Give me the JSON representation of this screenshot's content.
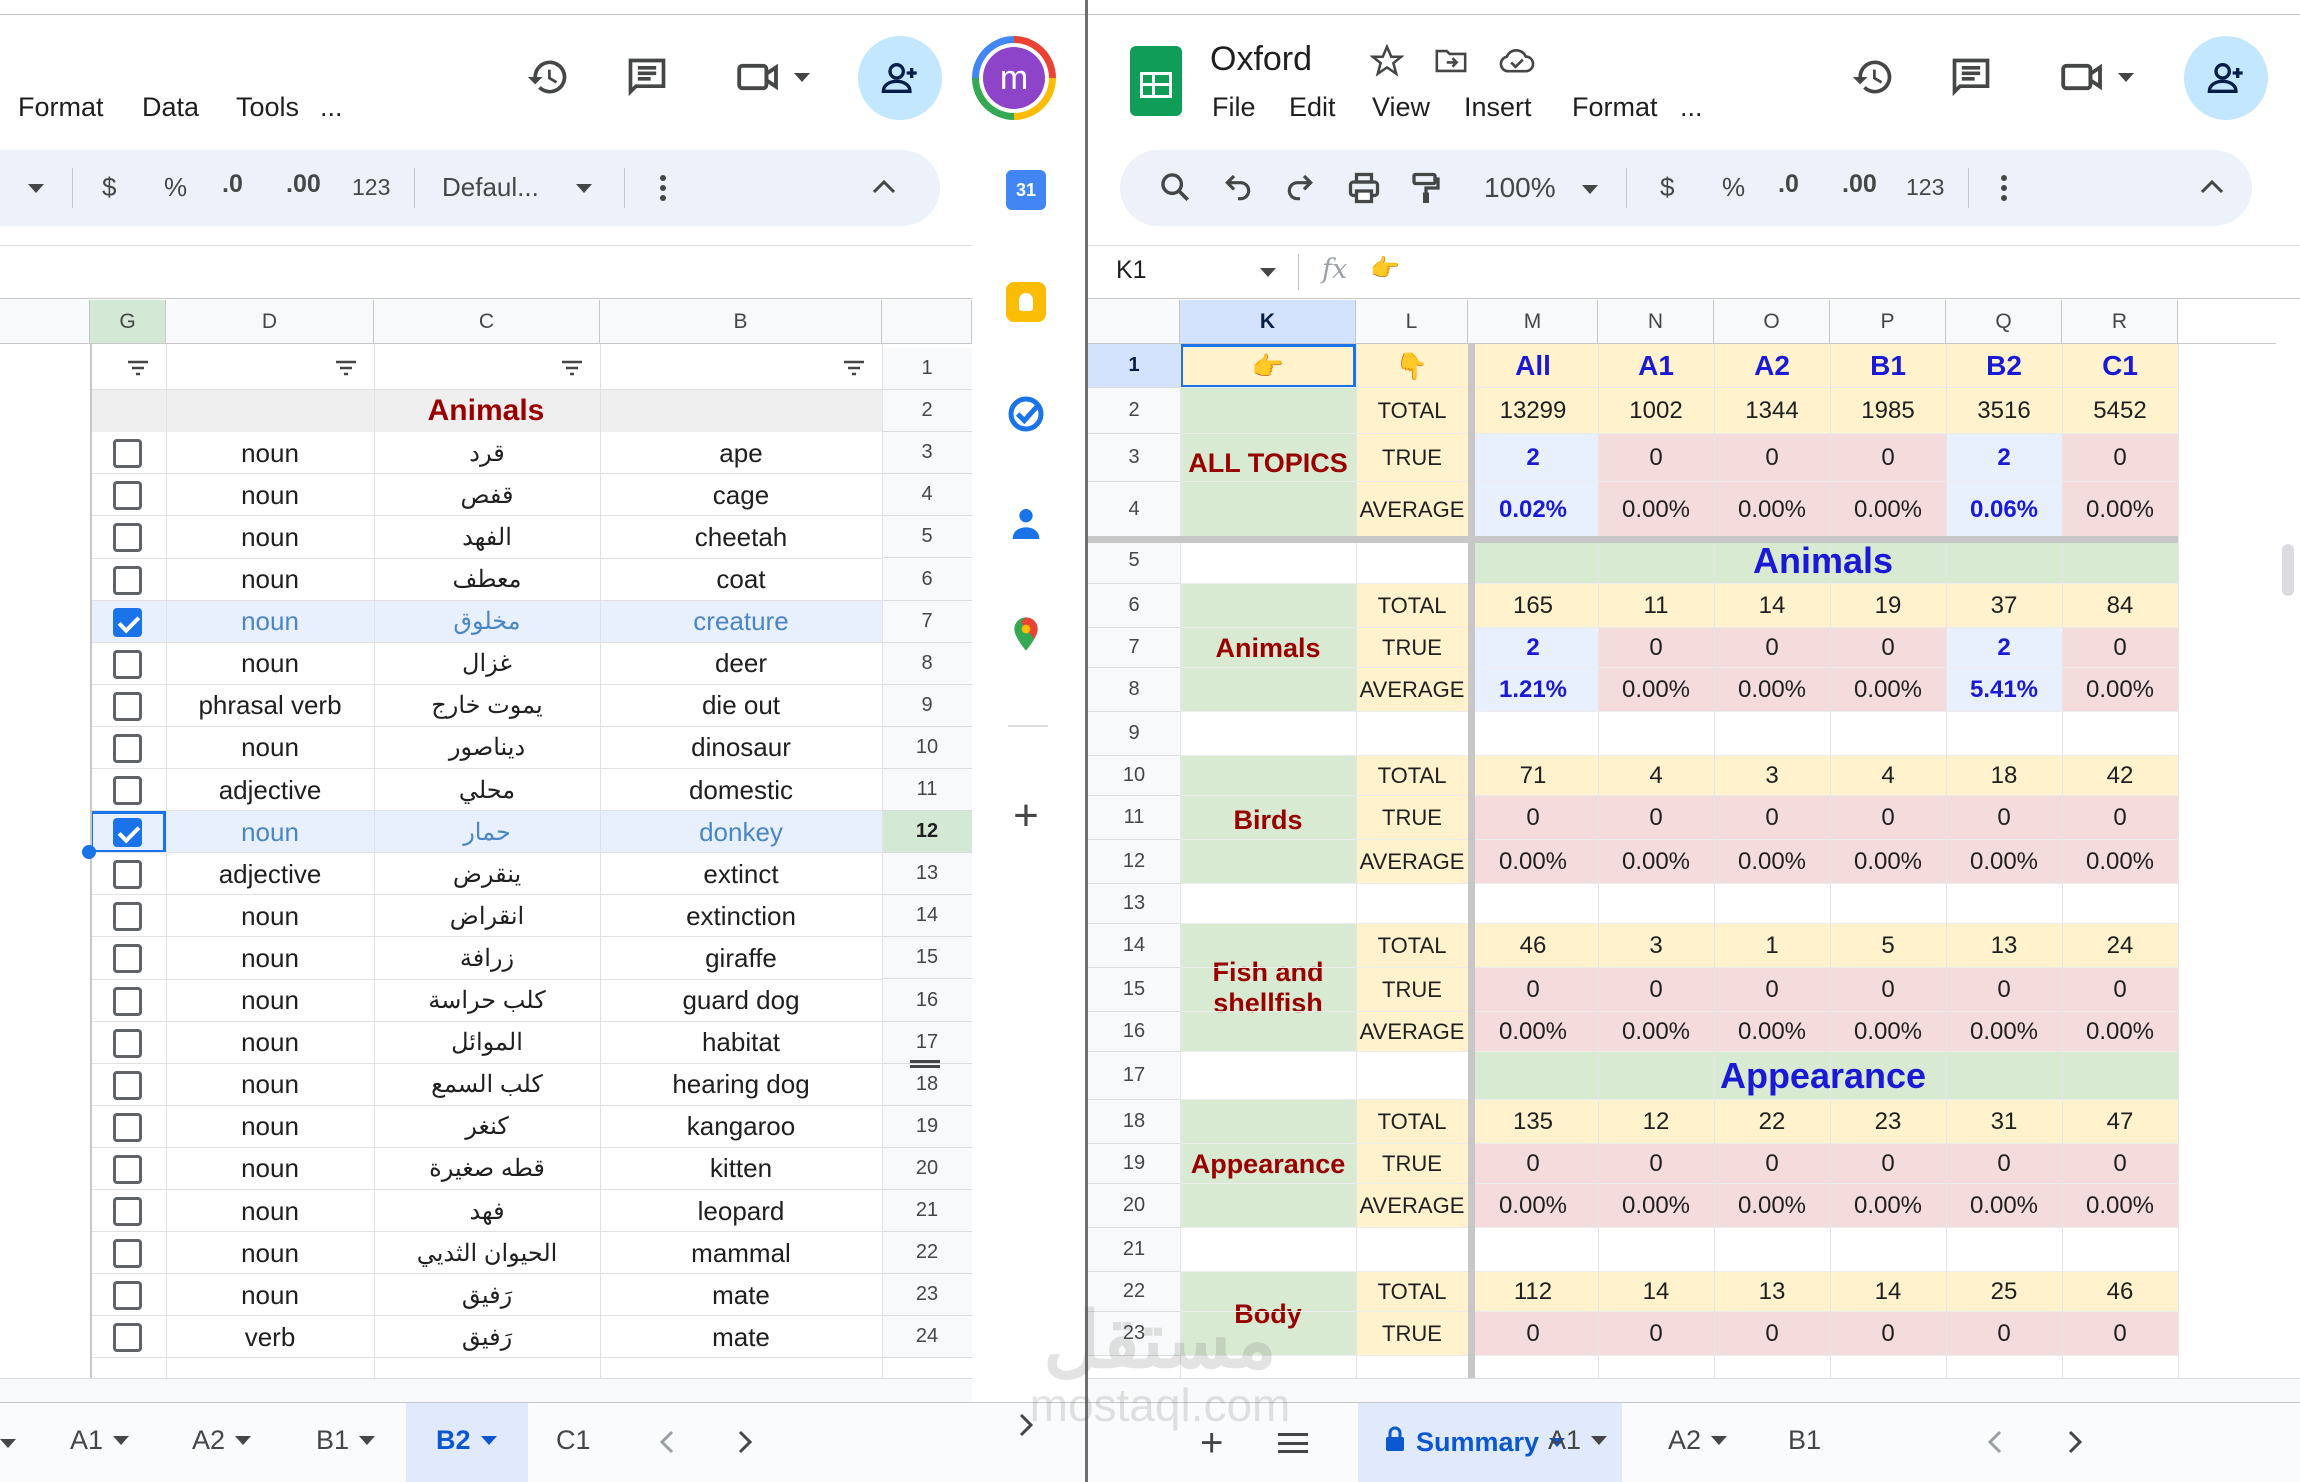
{
  "left": {
    "menu": [
      "Format",
      "Data",
      "Tools",
      "..."
    ],
    "toolbar": {
      "currency": "$",
      "percent": "%",
      "dec_minus": ".0",
      "dec_plus": ".00",
      "num_format": "123",
      "font": "Defaul..."
    },
    "avatar_letter": "m",
    "col_headers": [
      "G",
      "D",
      "C",
      "B"
    ],
    "section_title": "Animals",
    "rows": [
      {
        "n": "1",
        "d": "",
        "c": "",
        "b": "",
        "checked": false
      },
      {
        "n": "2",
        "d": "",
        "c": "",
        "b": "",
        "checked": false
      },
      {
        "n": "3",
        "d": "noun",
        "c": "قرد",
        "b": "ape",
        "checked": false
      },
      {
        "n": "4",
        "d": "noun",
        "c": "قفص",
        "b": "cage",
        "checked": false
      },
      {
        "n": "5",
        "d": "noun",
        "c": "الفهد",
        "b": "cheetah",
        "checked": false
      },
      {
        "n": "6",
        "d": "noun",
        "c": "معطف",
        "b": "coat",
        "checked": false
      },
      {
        "n": "7",
        "d": "noun",
        "c": "مخلوق",
        "b": "creature",
        "checked": true
      },
      {
        "n": "8",
        "d": "noun",
        "c": "غزال",
        "b": "deer",
        "checked": false
      },
      {
        "n": "9",
        "d": "phrasal verb",
        "c": "يموت خارج",
        "b": "die out",
        "checked": false
      },
      {
        "n": "10",
        "d": "noun",
        "c": "ديناصور",
        "b": "dinosaur",
        "checked": false
      },
      {
        "n": "11",
        "d": "adjective",
        "c": "محلي",
        "b": "domestic",
        "checked": false
      },
      {
        "n": "12",
        "d": "noun",
        "c": "حمار",
        "b": "donkey",
        "checked": true
      },
      {
        "n": "13",
        "d": "adjective",
        "c": "ينقرض",
        "b": "extinct",
        "checked": false
      },
      {
        "n": "14",
        "d": "noun",
        "c": "انقراض",
        "b": "extinction",
        "checked": false
      },
      {
        "n": "15",
        "d": "noun",
        "c": "زرافة",
        "b": "giraffe",
        "checked": false
      },
      {
        "n": "16",
        "d": "noun",
        "c": "كلب حراسة",
        "b": "guard dog",
        "checked": false
      },
      {
        "n": "17",
        "d": "noun",
        "c": "الموائل",
        "b": "habitat",
        "checked": false
      },
      {
        "n": "18",
        "d": "noun",
        "c": "كلب السمع",
        "b": "hearing dog",
        "checked": false
      },
      {
        "n": "19",
        "d": "noun",
        "c": "كنغر",
        "b": "kangaroo",
        "checked": false
      },
      {
        "n": "20",
        "d": "noun",
        "c": "قطه صغيرة",
        "b": "kitten",
        "checked": false
      },
      {
        "n": "21",
        "d": "noun",
        "c": "فهد",
        "b": "leopard",
        "checked": false
      },
      {
        "n": "22",
        "d": "noun",
        "c": "الحيوان الثديي",
        "b": "mammal",
        "checked": false
      },
      {
        "n": "23",
        "d": "noun",
        "c": "رَفيق",
        "b": "mate",
        "checked": false
      },
      {
        "n": "24",
        "d": "verb",
        "c": "رَفيق",
        "b": "mate",
        "checked": false
      }
    ],
    "tabs": [
      "A1",
      "A2",
      "B1",
      "B2",
      "C1"
    ],
    "active_tab": "B2"
  },
  "right": {
    "doc_title": "Oxford",
    "menu": [
      "File",
      "Edit",
      "View",
      "Insert",
      "Format",
      "..."
    ],
    "toolbar": {
      "zoom": "100%",
      "currency": "$",
      "percent": "%",
      "dec_minus": ".0",
      "dec_plus": ".00",
      "num_format": "123"
    },
    "name_box": "K1",
    "fx": "fx",
    "formula": "👉",
    "col_headers": [
      "K",
      "L",
      "M",
      "N",
      "O",
      "P",
      "Q",
      "R"
    ],
    "header_row": {
      "k": "👉",
      "l": "👇",
      "levels": [
        "All",
        "A1",
        "A2",
        "B1",
        "B2",
        "C1"
      ]
    },
    "row_numbers": [
      "1",
      "2",
      "3",
      "4",
      "5",
      "6",
      "7",
      "8",
      "9",
      "10",
      "11",
      "12",
      "13",
      "14",
      "15",
      "16",
      "17",
      "18",
      "19",
      "20",
      "21",
      "22",
      "23"
    ],
    "labels": {
      "total": "TOTAL",
      "true": "TRUE",
      "average": "AVERAGE"
    },
    "all_topics": {
      "name": "ALL TOPICS",
      "total": [
        "13299",
        "1002",
        "1344",
        "1985",
        "3516",
        "5452"
      ],
      "true": [
        "2",
        "0",
        "0",
        "0",
        "2",
        "0"
      ],
      "average": [
        "0.02%",
        "0.00%",
        "0.00%",
        "0.00%",
        "0.06%",
        "0.00%"
      ]
    },
    "sections": [
      {
        "title": "Animals",
        "groups": [
          {
            "name": "Animals",
            "total": [
              "165",
              "11",
              "14",
              "19",
              "37",
              "84"
            ],
            "true": [
              "2",
              "0",
              "0",
              "0",
              "2",
              "0"
            ],
            "average": [
              "1.21%",
              "0.00%",
              "0.00%",
              "0.00%",
              "5.41%",
              "0.00%"
            ]
          },
          {
            "name": "Birds",
            "total": [
              "71",
              "4",
              "3",
              "4",
              "18",
              "42"
            ],
            "true": [
              "0",
              "0",
              "0",
              "0",
              "0",
              "0"
            ],
            "average": [
              "0.00%",
              "0.00%",
              "0.00%",
              "0.00%",
              "0.00%",
              "0.00%"
            ]
          },
          {
            "name": "Fish and shellfish",
            "total": [
              "46",
              "3",
              "1",
              "5",
              "13",
              "24"
            ],
            "true": [
              "0",
              "0",
              "0",
              "0",
              "0",
              "0"
            ],
            "average": [
              "0.00%",
              "0.00%",
              "0.00%",
              "0.00%",
              "0.00%",
              "0.00%"
            ]
          }
        ]
      },
      {
        "title": "Appearance",
        "groups": [
          {
            "name": "Appearance",
            "total": [
              "135",
              "12",
              "22",
              "23",
              "31",
              "47"
            ],
            "true": [
              "0",
              "0",
              "0",
              "0",
              "0",
              "0"
            ],
            "average": [
              "0.00%",
              "0.00%",
              "0.00%",
              "0.00%",
              "0.00%",
              "0.00%"
            ]
          },
          {
            "name": "Body",
            "total": [
              "112",
              "14",
              "13",
              "14",
              "25",
              "46"
            ],
            "true": [
              "0",
              "0",
              "0",
              "0",
              "0",
              "0"
            ],
            "average": []
          }
        ]
      }
    ],
    "tabs": [
      "Summary",
      "A1",
      "A2",
      "B1"
    ],
    "active_tab": "Summary"
  },
  "watermark": {
    "arabic": "مستقل",
    "latin": "mostaql.com"
  },
  "colors": {
    "dark_red": "#990000",
    "blue_title": "#1a1ad6",
    "green_band": "#d9ead3",
    "yellow_band": "#fff2cc",
    "pink_band": "#f4dcdc",
    "light_blue": "#e8f0fe",
    "checkbox_blue": "#1a73e8"
  }
}
